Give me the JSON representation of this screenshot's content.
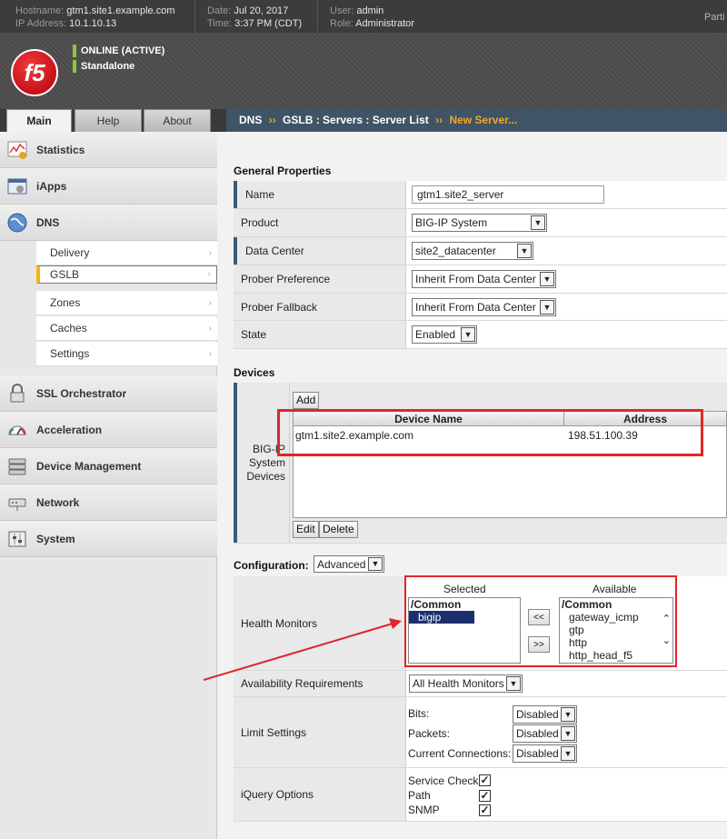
{
  "header": {
    "hostname_label": "Hostname:",
    "hostname": "gtm1.site1.example.com",
    "ip_label": "IP Address:",
    "ip": "10.1.10.13",
    "date_label": "Date:",
    "date": "Jul 20, 2017",
    "time_label": "Time:",
    "time": "3:37 PM (CDT)",
    "user_label": "User:",
    "user": "admin",
    "role_label": "Role:",
    "role": "Administrator",
    "partition": "Parti"
  },
  "banner": {
    "logo": "f5",
    "status": "ONLINE (ACTIVE)",
    "mode": "Standalone",
    "status_color": "#8cc63f"
  },
  "tabs": {
    "main": "Main",
    "help": "Help",
    "about": "About"
  },
  "breadcrumb": {
    "part1": "DNS",
    "sep1": "››",
    "part2": "GSLB : Servers : Server List",
    "sep2": "››",
    "current": "New Server..."
  },
  "nav": {
    "statistics": "Statistics",
    "iapps": "iApps",
    "dns": "DNS",
    "dns_items": [
      "Delivery",
      "GSLB",
      "Zones",
      "Caches",
      "Settings"
    ],
    "ssl": "SSL Orchestrator",
    "acceleration": "Acceleration",
    "device_mgmt": "Device Management",
    "network": "Network",
    "system": "System"
  },
  "general": {
    "title": "General Properties",
    "name_label": "Name",
    "name_value": "gtm1.site2_server",
    "product_label": "Product",
    "product_value": "BIG-IP System",
    "dc_label": "Data Center",
    "dc_value": "site2_datacenter",
    "prober_pref_label": "Prober Preference",
    "prober_pref_value": "Inherit From Data Center",
    "prober_fb_label": "Prober Fallback",
    "prober_fb_value": "Inherit From Data Center",
    "state_label": "State",
    "state_value": "Enabled"
  },
  "devices": {
    "title": "Devices",
    "label_line1": "BIG-IP",
    "label_line2": "System",
    "label_line3": "Devices",
    "add": "Add",
    "col_name": "Device Name",
    "col_address": "Address",
    "rows": [
      {
        "name": "gtm1.site2.example.com",
        "address": "198.51.100.39"
      }
    ],
    "edit": "Edit",
    "delete": "Delete"
  },
  "config": {
    "title": "Configuration:",
    "mode": "Advanced",
    "hm_label": "Health Monitors",
    "selected_label": "Selected",
    "available_label": "Available",
    "selected_group": "/Common",
    "selected_items": [
      "bigip"
    ],
    "available_group": "/Common",
    "available_items": [
      "gateway_icmp",
      "gtp",
      "http",
      "http_head_f5"
    ],
    "move_left": "<<",
    "move_right": ">>",
    "avail_req_label": "Availability Requirements",
    "avail_req_value": "All Health Monitors",
    "limit_label": "Limit Settings",
    "bits_label": "Bits:",
    "bits_value": "Disabled",
    "packets_label": "Packets:",
    "packets_value": "Disabled",
    "conn_label": "Current Connections:",
    "conn_value": "Disabled",
    "iquery_label": "iQuery Options",
    "service_check": "Service Check",
    "path": "Path",
    "snmp": "SNMP",
    "checkmark": "✓"
  },
  "annotation_color": "#e0262b"
}
